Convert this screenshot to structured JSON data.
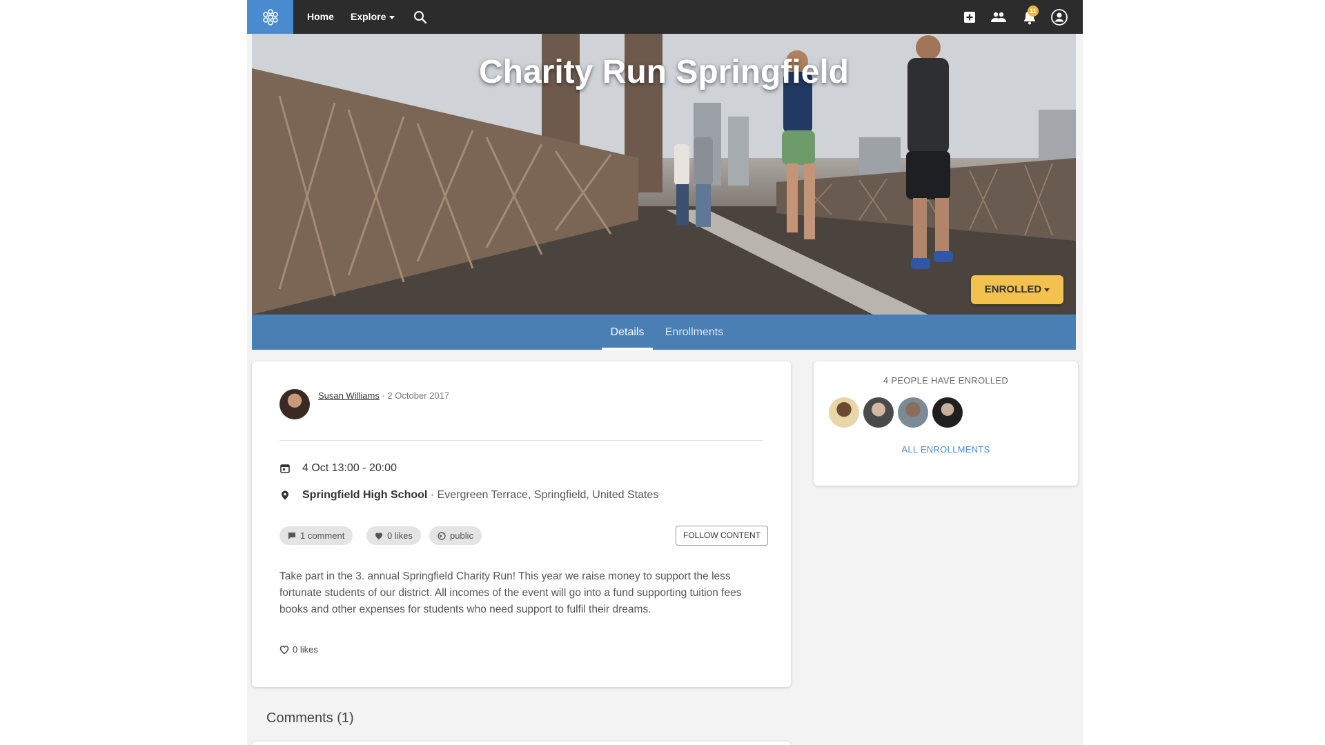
{
  "nav": {
    "home_label": "Home",
    "explore_label": "Explore",
    "notification_count": "11",
    "icons": [
      "logo-icon",
      "search-icon",
      "add-icon",
      "group-icon",
      "bell-icon",
      "user-avatar-icon"
    ]
  },
  "hero": {
    "title": "Charity Run Springfield",
    "enroll_button_label": "ENROLLED"
  },
  "tabs": [
    {
      "label": "Details",
      "active": true
    },
    {
      "label": "Enrollments",
      "active": false
    }
  ],
  "post": {
    "author": "Susan Williams",
    "date": "· 2 October 2017",
    "event_time": "4 Oct 13:00 - 20:00",
    "location_name": "Springfield High School",
    "location_address": "· Evergreen Terrace, Springfield, United States",
    "pills": {
      "comments": "1 comment",
      "likes": "0 likes",
      "visibility": "public"
    },
    "follow_label": "FOLLOW CONTENT",
    "description": "Take part in the 3. annual Springfield Charity Run! This year we raise money to support the less fortunate students of our district. All incomes of the event will go into a fund supporting tuition fees books and other expenses for students who need support to fulfil their dreams.",
    "like_label": "0 likes"
  },
  "enrollments": {
    "title": "4 PEOPLE HAVE ENROLLED",
    "all_label": "ALL ENROLLMENTS"
  },
  "comments": {
    "title": "Comments (1)"
  },
  "colors": {
    "nav_bg": "#2c2c2c",
    "brand": "#4a8bd0",
    "tab_bar": "#4a7fb3",
    "enroll_button": "#f2c14e"
  }
}
